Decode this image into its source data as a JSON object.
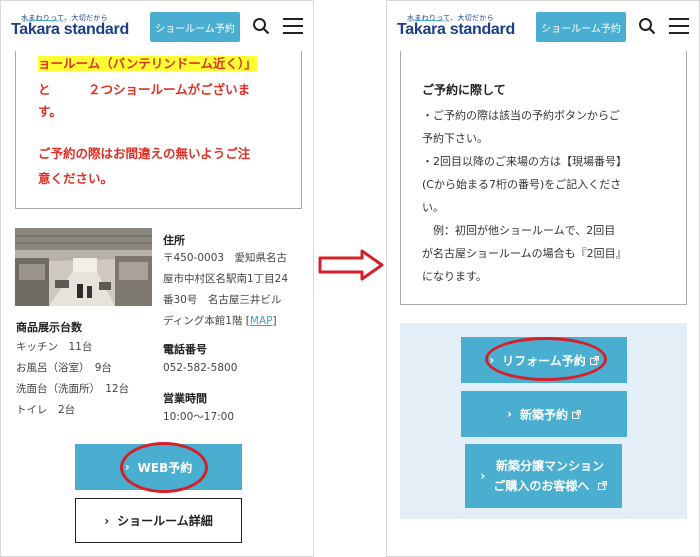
{
  "header": {
    "logo_tagline": "水まわりって、大切だから",
    "logo_main": "Takara standard",
    "showroom_reserve_label": "ショールーム予約"
  },
  "left": {
    "notice_lines": [
      "ョールーム（バンテリンドーム近く）」",
      "と　　　２つショールームがございま",
      "す。",
      "ご予約の際はお間違えの無いようご注",
      "意ください。"
    ],
    "exhibit": {
      "title": "商品展示台数",
      "items": [
        "キッチン　11台",
        "お風呂（浴室）　9台",
        "洗面台（洗面所）　12台",
        "トイレ　2台"
      ]
    },
    "address": {
      "title": "住所",
      "lines": [
        "〒450-0003　愛知県名古",
        "屋市中村区名駅南1丁目24",
        "番30号　名古屋三井ビル"
      ],
      "last_line_prefix": "ディング本館1階",
      "map_label": "MAP"
    },
    "phone": {
      "title": "電話番号",
      "value": "052-582-5800"
    },
    "hours": {
      "title": "営業時間",
      "value": "10:00～17:00"
    },
    "web_reserve_label": "WEB予約",
    "showroom_detail_label": "ショールーム詳細"
  },
  "right": {
    "notice_title": "ご予約に際して",
    "notice_lines": [
      "・ご予約の際は該当の予約ボタンからご",
      "予約下さい。",
      "・2回目以降のご来場の方は【現場番号】",
      "(Cから始まる7桁の番号)をご記入くださ",
      "い。",
      "　例：初回が他ショールームで、2回目",
      "が名古屋ショールームの場合も『2回目』",
      "になります。"
    ],
    "reform_label": "リフォーム予約",
    "newbuild_label": "新築予約",
    "condo_line1": "新築分譲マンション",
    "condo_line2": "ご購入のお客様へ"
  },
  "colors": {
    "accent_blue": "#4aaed0",
    "logo_navy": "#1b3f8b",
    "notice_red": "#e03025",
    "highlight_yellow": "#ffff33",
    "annotation_red": "#d42029",
    "panel_light_blue": "#e4eef7"
  }
}
